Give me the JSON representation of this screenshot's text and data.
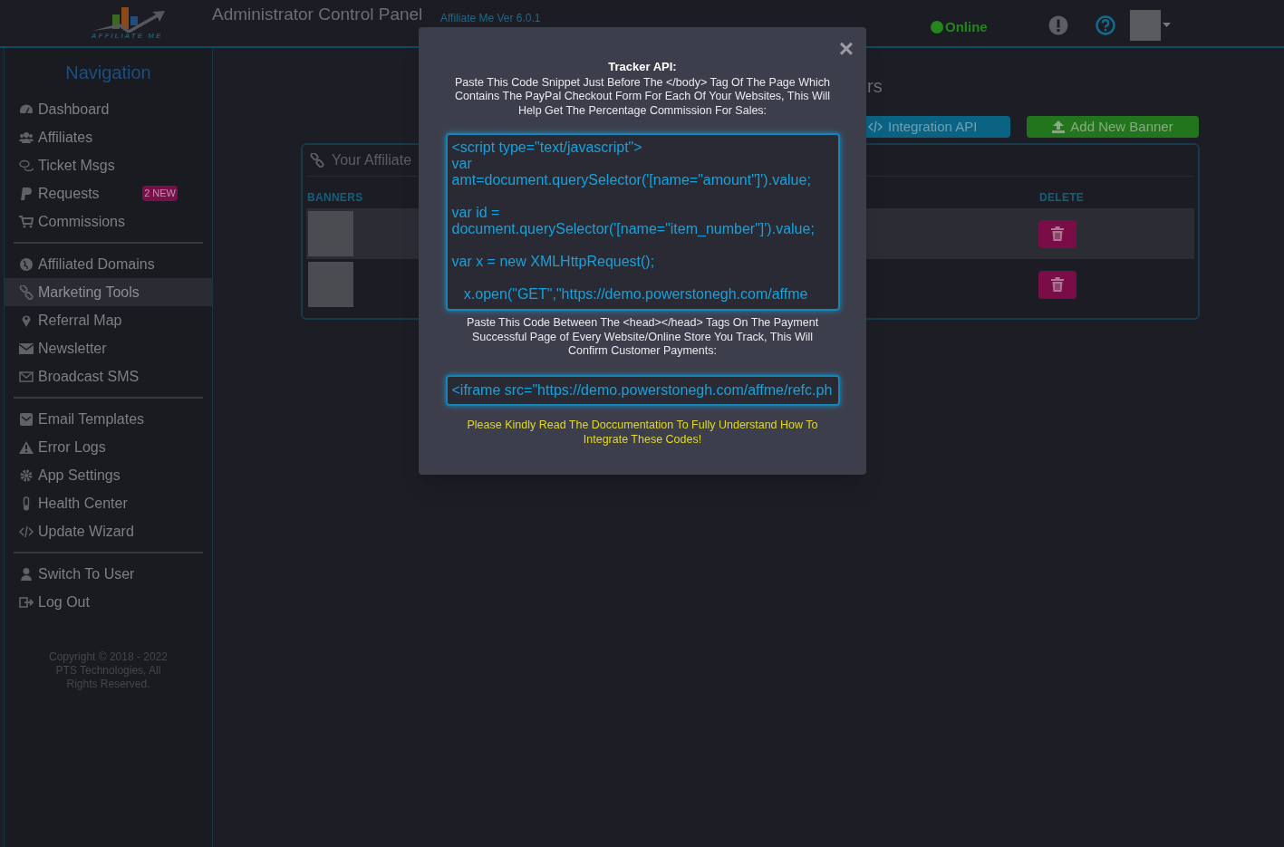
{
  "header": {
    "logo_text": "AFFILIATE ME",
    "title": "Administrator Control Panel",
    "version": "Affiliate Me Ver 6.0.1",
    "status": "Online"
  },
  "sidebar": {
    "heading": "Navigation",
    "groups": [
      [
        {
          "label": "Dashboard",
          "selected": false
        },
        {
          "label": "Affiliates",
          "selected": false
        },
        {
          "label": "Ticket Msgs",
          "selected": false
        },
        {
          "label": "Requests",
          "selected": false,
          "badge": "2 NEW"
        },
        {
          "label": "Commissions",
          "selected": false
        }
      ],
      [
        {
          "label": "Affiliated Domains",
          "selected": false
        },
        {
          "label": "Marketing Tools",
          "selected": true
        },
        {
          "label": "Referral Map",
          "selected": false
        },
        {
          "label": "Newsletter",
          "selected": false
        },
        {
          "label": "Broadcast SMS",
          "selected": false
        }
      ],
      [
        {
          "label": "Email Templates",
          "selected": false
        },
        {
          "label": "Error Logs",
          "selected": false
        },
        {
          "label": "App Settings",
          "selected": false
        },
        {
          "label": "Health Center",
          "selected": false
        },
        {
          "label": "Update Wizard",
          "selected": false
        }
      ],
      [
        {
          "label": "Switch To User",
          "selected": false
        },
        {
          "label": "Log Out",
          "selected": false
        }
      ]
    ],
    "copyright": "Copyright © 2018 - 2022 PTS Technologies, All Rights Reserved."
  },
  "page": {
    "heading_fragment": "rs",
    "buttons": [
      {
        "kind": "code",
        "label": "Integration API"
      },
      {
        "kind": "upload",
        "label": "Add New Banner"
      }
    ],
    "card": {
      "title": "Your Affiliate",
      "columns": [
        "BANNERS",
        "DELETE"
      ],
      "rows": [
        {
          "striped": true
        },
        {
          "striped": false
        }
      ]
    }
  },
  "modal": {
    "close": "×",
    "title": "Tracker API:",
    "intro": "Paste This Code Snippet Just Before The </body> Tag Of The Page Which Contains The PayPal Checkout Form For Each Of Your Websites, This Will Help Get The Percentage Commission For Sales:",
    "script_code": "<script type=\"text/javascript\">\nvar\namt=document.querySelector('[name=\"amount\"]').value;\n\nvar id =\ndocument.querySelector('[name=\"item_number\"]').value;\n\nvar x = new XMLHttpRequest();\n\n   x.open(\"GET\",\"https://demo.powerstonegh.com/affme",
    "second_intro": "Paste This Code Between The <head></head> Tags On The Payment Successful Page of Every Website/Online Store You Track, This Will Confirm Customer Payments:",
    "iframe_code": "<iframe src=\"https://demo.powerstonegh.com/affme/refc.ph",
    "notice": "Please Kindly Read The Doccumentation To Fully Understand How To Integrate These Codes!"
  }
}
